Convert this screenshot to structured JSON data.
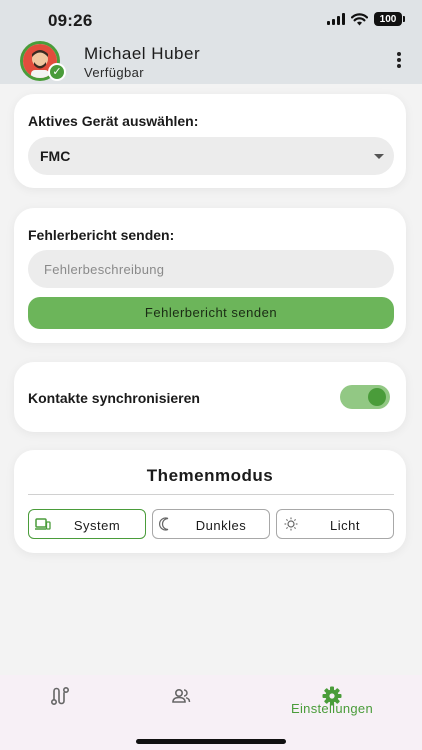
{
  "status_bar": {
    "time": "09:26",
    "battery": "100"
  },
  "header": {
    "name": "Michael Huber",
    "status": "Verfügbar"
  },
  "device_card": {
    "title": "Aktives Gerät auswählen:",
    "selected": "FMC"
  },
  "report_card": {
    "title": "Fehlerbericht senden:",
    "input_placeholder": "Fehlerbeschreibung",
    "input_value": "",
    "button_label": "Fehlerbericht senden"
  },
  "sync_card": {
    "label": "Kontakte synchronisieren",
    "enabled": true
  },
  "theme_card": {
    "title": "Themenmodus",
    "options": [
      {
        "label": "System",
        "active": true
      },
      {
        "label": "Dunkles",
        "active": false
      },
      {
        "label": "Licht",
        "active": false
      }
    ]
  },
  "bottom_nav": {
    "items": [
      {
        "icon": "route-icon",
        "label": ""
      },
      {
        "icon": "contacts-icon",
        "label": ""
      },
      {
        "icon": "gear-icon",
        "label": "Einstellungen",
        "active": true
      }
    ]
  },
  "colors": {
    "accent": "#4a9c3a",
    "button_green": "#6cb55a",
    "header_bg": "#dfe3e6"
  }
}
